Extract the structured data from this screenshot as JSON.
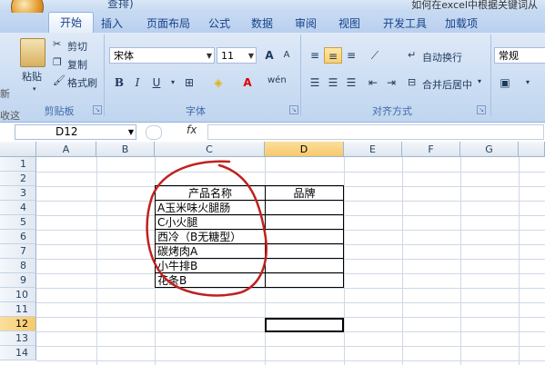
{
  "window": {
    "title": "如何在excel中根据关键词从",
    "qat_text": "查排)"
  },
  "tabs": [
    "开始",
    "插入",
    "页面布局",
    "公式",
    "数据",
    "审阅",
    "视图",
    "开发工具",
    "加载项"
  ],
  "ribbon": {
    "clipboard": {
      "paste": "粘贴",
      "cut": "剪切",
      "copy": "复制",
      "format_painter": "格式刷",
      "label": "剪贴板"
    },
    "font": {
      "name": "宋体",
      "size": "11",
      "bold": "B",
      "italic": "I",
      "underline": "U",
      "grow": "A",
      "shrink": "A",
      "phonetic": "wén",
      "label": "字体"
    },
    "alignment": {
      "wrap": "自动换行",
      "merge": "合并后居中",
      "label": "对齐方式"
    },
    "number": {
      "format": "常规"
    },
    "accent": "#c4d8f1",
    "selected_accent": "#f7c96b"
  },
  "left_fragment": [
    "新",
    "收这"
  ],
  "formula_bar": {
    "cell_ref": "D12",
    "fx": "fx",
    "value": ""
  },
  "columns": [
    "A",
    "B",
    "C",
    "D",
    "E",
    "F",
    "G"
  ],
  "rows": [
    "1",
    "2",
    "3",
    "4",
    "5",
    "6",
    "7",
    "8",
    "9",
    "10",
    "11",
    "12",
    "13",
    "14"
  ],
  "table": {
    "header_product": "产品名称",
    "header_brand": "品牌",
    "products": [
      "A玉米味火腿肠",
      "C小火腿",
      "西冷（B无糖型）",
      "碳烤肉A",
      "小牛排B",
      "花条B"
    ]
  }
}
